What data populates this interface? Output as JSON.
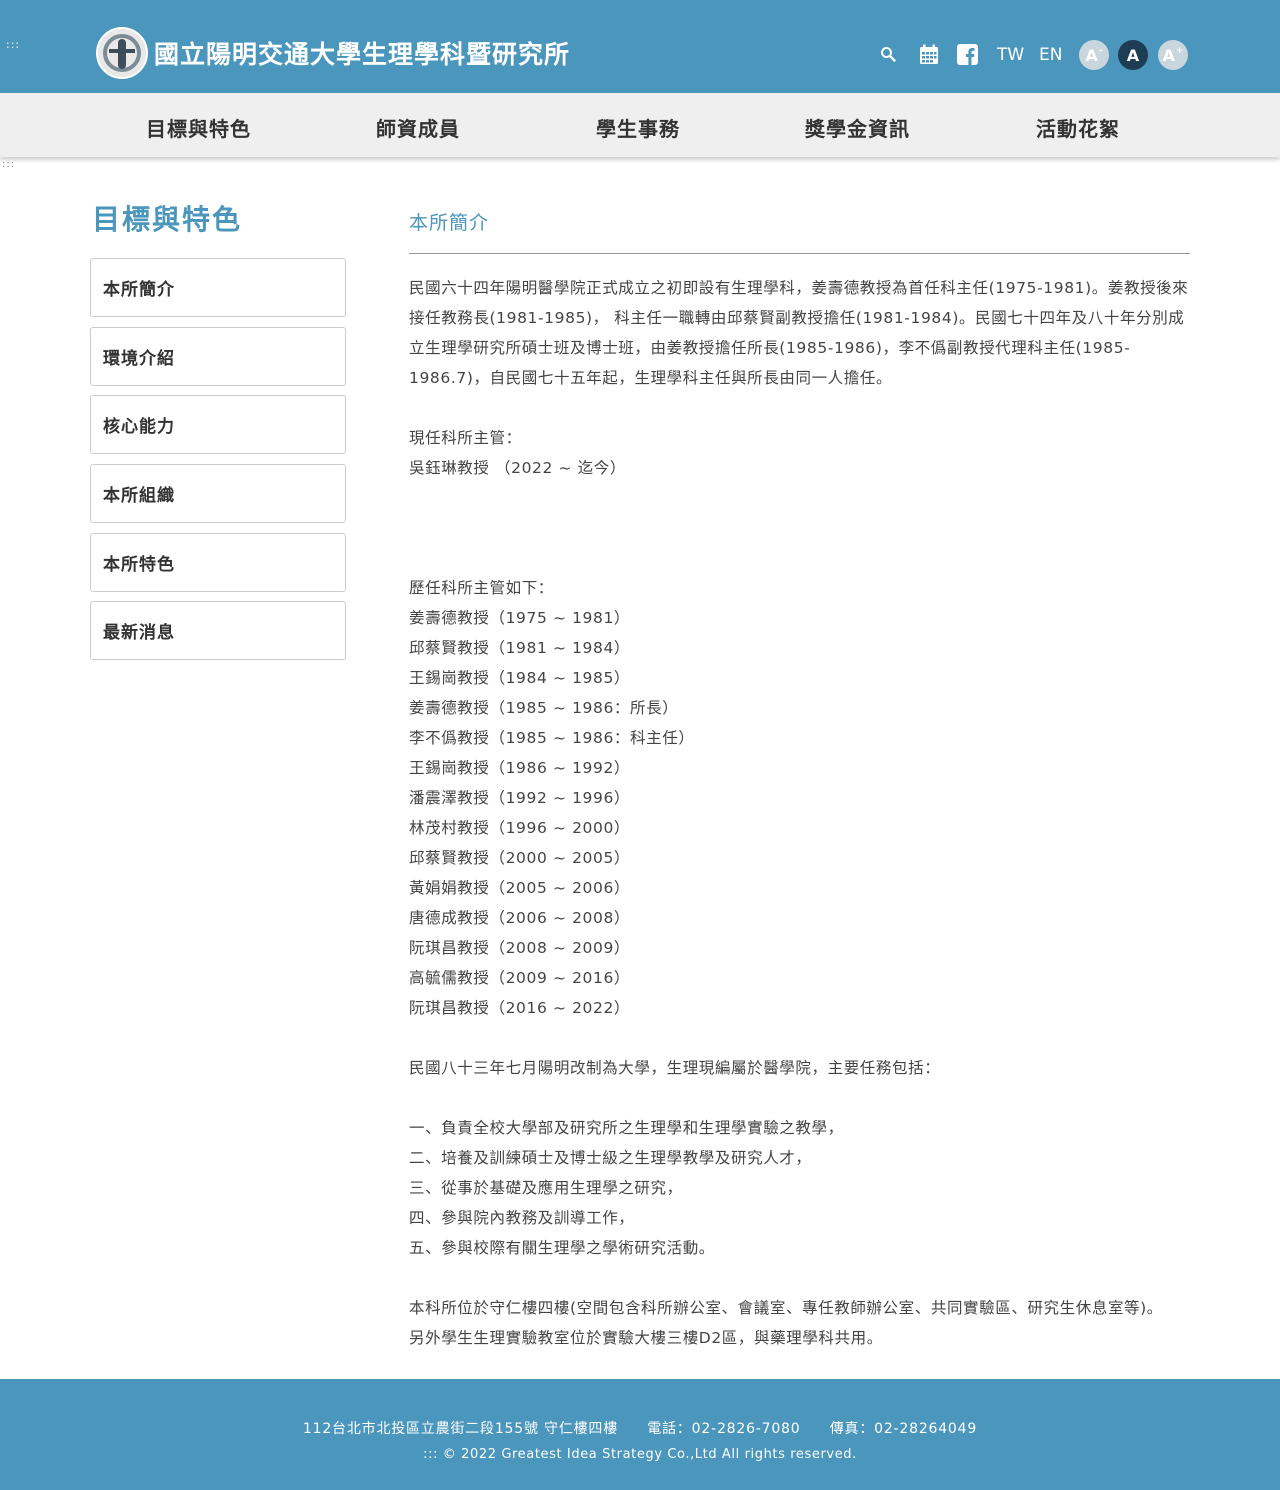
{
  "accesskeys": {
    "top": ":::",
    "content": ":::"
  },
  "header": {
    "title": "國立陽明交通大學生理學科暨研究所",
    "tools": {
      "search_icon": "search-icon",
      "calendar_icon": "calendar-icon",
      "facebook_icon": "facebook-icon",
      "lang_tw": "TW",
      "lang_en": "EN",
      "font_small": "A",
      "font_small_mark": "-",
      "font_medium": "A",
      "font_large": "A",
      "font_large_mark": "+"
    }
  },
  "nav": {
    "items": [
      "目標與特色",
      "師資成員",
      "學生事務",
      "獎學金資訊",
      "活動花絮"
    ]
  },
  "sidebar": {
    "title": "目標與特色",
    "items": [
      "本所簡介",
      "環境介紹",
      "核心能力",
      "本所組織",
      "本所特色",
      "最新消息"
    ]
  },
  "main": {
    "title": "本所簡介",
    "intro": "民國六十四年陽明醫學院正式成立之初即設有生理學科，姜壽德教授為首任科主任(1975-1981)。姜教授後來接任教務長(1981-1985)， 科主任一職轉由邱蔡賢副教授擔任(1981-1984)。民國七十四年及八十年分別成立生理學研究所碩士班及博士班，由姜教授擔任所長(1985-1986)，李不僞副教授代理科主任(1985-1986.7)，自民國七十五年起，生理學科主任與所長由同一人擔任。",
    "current_label": "現任科所主管：",
    "current": "吳鈺琳教授 （2022 ~ 迄今）",
    "history_label": "歷任科所主管如下：",
    "history": [
      "姜壽德教授（1975 ~ 1981）",
      "邱蔡賢教授（1981 ~ 1984）",
      "王錫崗教授（1984 ~ 1985）",
      "姜壽德教授（1985 ~ 1986：所長）",
      "李不僞教授（1985 ~ 1986：科主任）",
      "王錫崗教授（1986 ~ 1992）",
      "潘震澤教授（1992 ~ 1996）",
      "林茂村教授（1996 ~ 2000）",
      "邱蔡賢教授（2000 ~ 2005）",
      "黃娟娟教授（2005 ~ 2006）",
      "唐德成教授（2006 ~ 2008）",
      "阮琪昌教授（2008 ~ 2009）",
      "高毓儒教授（2009 ~ 2016）",
      "阮琪昌教授（2016 ~ 2022）"
    ],
    "mission_intro": "民國八十三年七月陽明改制為大學，生理現編屬於醫學院，主要任務包括：",
    "missions": [
      "一、負責全校大學部及研究所之生理學和生理學實驗之教學，",
      "二、培養及訓練碩士及博士級之生理學教學及研究人才，",
      "三、從事於基礎及應用生理學之研究，",
      "四、參與院內教務及訓導工作，",
      "五、參與校際有關生理學之學術研究活動。"
    ],
    "location_1": "本科所位於守仁樓四樓(空間包含科所辦公室、會議室、專任教師辦公室、共同實驗區、研究生休息室等)。",
    "location_2": "另外學生生理實驗教室位於實驗大樓三樓D2區，與藥理學科共用。"
  },
  "footer": {
    "address": "112台北市北投區立農街二段155號 守仁樓四樓",
    "phone": "電話：02-2826-7080",
    "fax": "傳真：02-28264049",
    "accesskey": ":::",
    "copyright": "© 2022 Greatest Idea Strategy Co.,Ltd All rights reserved."
  },
  "colors": {
    "brand": "#4b96bc",
    "nav_bg": "#efefef",
    "font_dark": "#1d3e52"
  }
}
